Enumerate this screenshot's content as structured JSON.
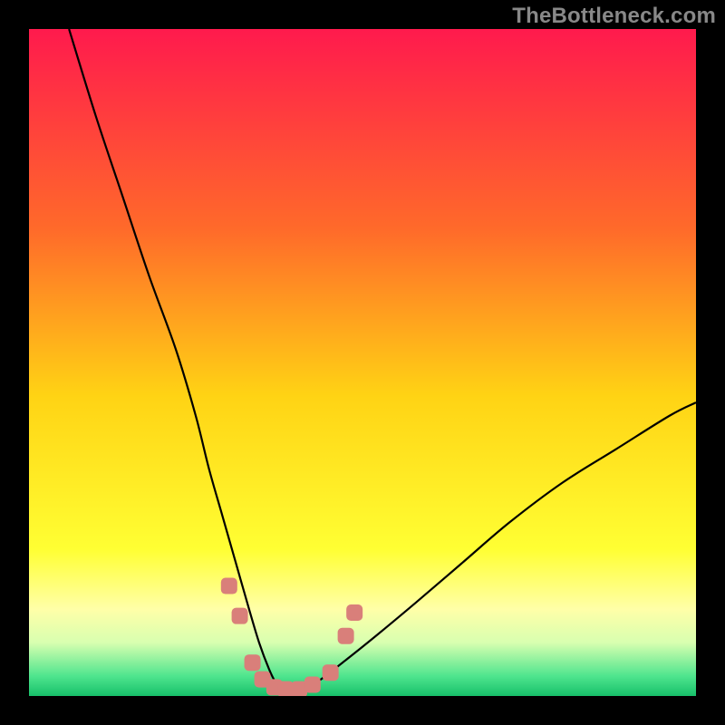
{
  "watermark": "TheBottleneck.com",
  "chart_data": {
    "type": "line",
    "title": "",
    "xlabel": "",
    "ylabel": "",
    "xlim": [
      0,
      100
    ],
    "ylim": [
      0,
      100
    ],
    "grid": false,
    "legend": false,
    "background_gradient_stops": [
      {
        "offset": 0.0,
        "color": "#ff1a4d"
      },
      {
        "offset": 0.3,
        "color": "#ff6a2a"
      },
      {
        "offset": 0.55,
        "color": "#ffd314"
      },
      {
        "offset": 0.78,
        "color": "#ffff33"
      },
      {
        "offset": 0.87,
        "color": "#ffffa8"
      },
      {
        "offset": 0.92,
        "color": "#d8ffb0"
      },
      {
        "offset": 0.97,
        "color": "#4fe58e"
      },
      {
        "offset": 1.0,
        "color": "#17c06a"
      }
    ],
    "series": [
      {
        "name": "bottleneck-curve",
        "color": "#000000",
        "x": [
          6,
          10,
          14,
          18,
          22,
          25,
          27,
          29,
          31,
          33,
          34.5,
          36,
          37,
          38,
          40,
          43,
          47,
          52,
          58,
          65,
          72,
          80,
          88,
          96,
          100
        ],
        "y": [
          100,
          87,
          75,
          63,
          52,
          42,
          34,
          27,
          20,
          13,
          8,
          4,
          2,
          1,
          1,
          2,
          5,
          9,
          14,
          20,
          26,
          32,
          37,
          42,
          44
        ]
      }
    ],
    "scatter_overlay": {
      "name": "bottom-markers",
      "color": "#d97f7a",
      "marker_size": 18,
      "points": [
        {
          "x": 30.0,
          "y": 16.5
        },
        {
          "x": 31.6,
          "y": 12.0
        },
        {
          "x": 33.5,
          "y": 5.0
        },
        {
          "x": 35.0,
          "y": 2.5
        },
        {
          "x": 36.8,
          "y": 1.3
        },
        {
          "x": 38.5,
          "y": 1.0
        },
        {
          "x": 40.5,
          "y": 1.0
        },
        {
          "x": 42.5,
          "y": 1.7
        },
        {
          "x": 45.2,
          "y": 3.5
        },
        {
          "x": 47.5,
          "y": 9.0
        },
        {
          "x": 48.8,
          "y": 12.5
        }
      ]
    }
  }
}
